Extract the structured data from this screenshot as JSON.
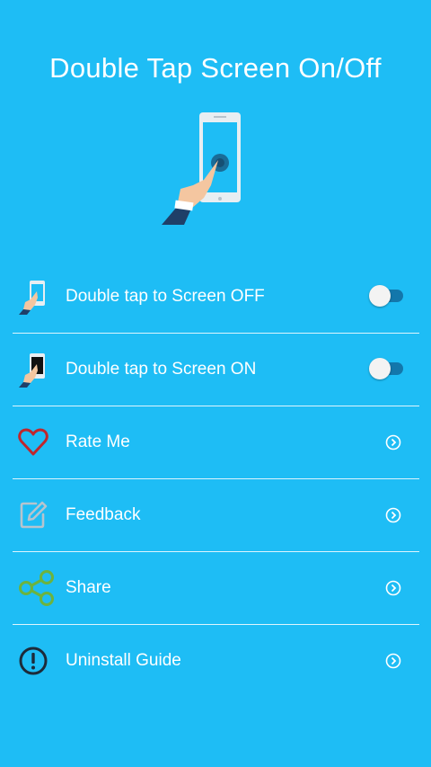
{
  "app": {
    "title": "Double Tap Screen On/Off"
  },
  "settings": {
    "items": [
      {
        "label": "Double tap to Screen OFF",
        "control": "toggle",
        "checked": false
      },
      {
        "label": "Double tap to Screen ON",
        "control": "toggle",
        "checked": false
      }
    ]
  },
  "menu": {
    "items": [
      {
        "label": "Rate Me",
        "icon": "heart-icon"
      },
      {
        "label": "Feedback",
        "icon": "edit-icon"
      },
      {
        "label": "Share",
        "icon": "share-icon"
      },
      {
        "label": "Uninstall Guide",
        "icon": "exclamation-icon"
      }
    ]
  },
  "colors": {
    "background": "#1EBDF5",
    "toggle_track": "#1377AB",
    "heart": "#C0262C",
    "share": "#6CB33E"
  }
}
